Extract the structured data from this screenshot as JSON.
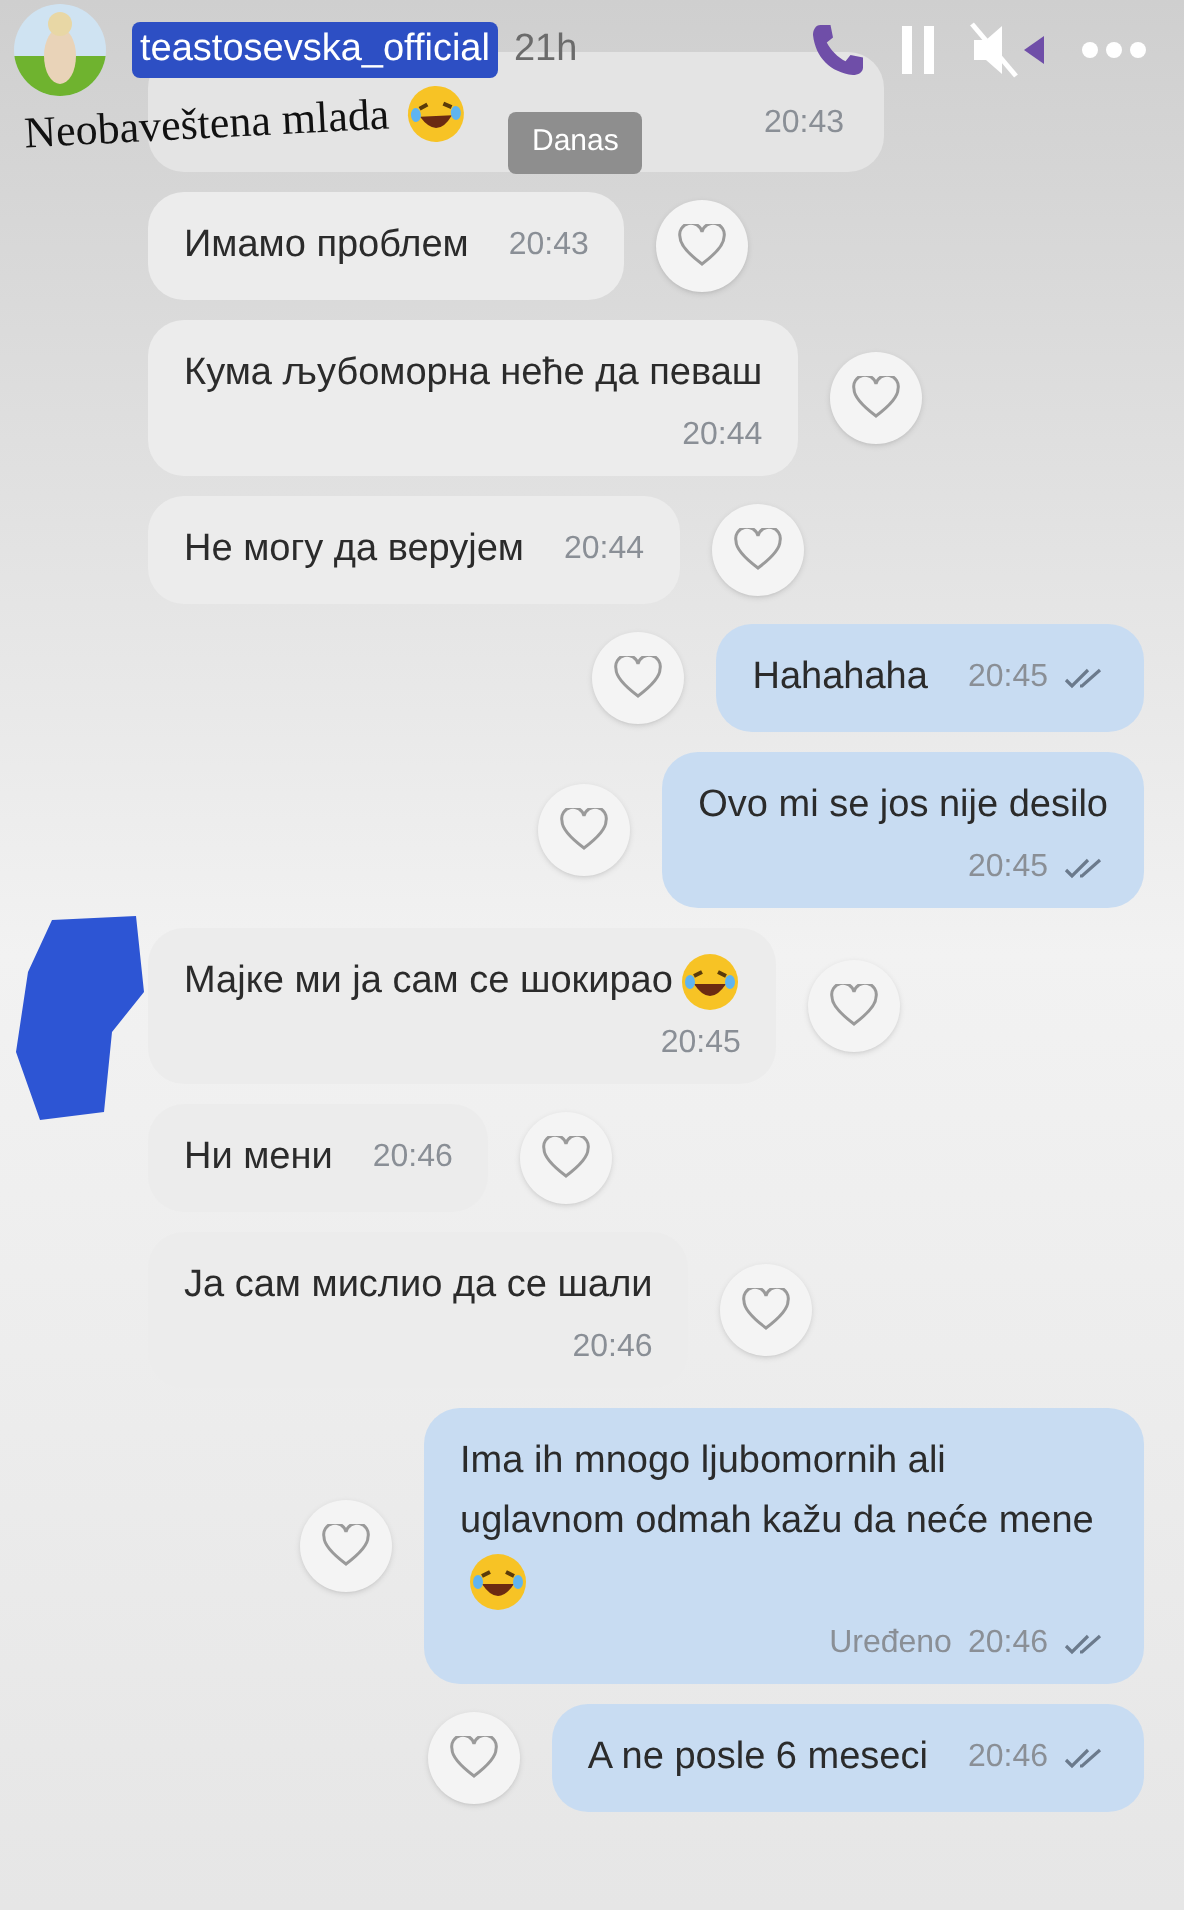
{
  "story": {
    "username": "teastosevska_official",
    "age": "21h",
    "caption": "Neobaveštena mlada"
  },
  "chat": {
    "date_chip": "Danas",
    "first_time": "20:43",
    "messages": [
      {
        "kind": "in",
        "text": "Имамо проблем",
        "time": "20:43",
        "time_below": false,
        "emoji": false
      },
      {
        "kind": "in",
        "text": "Кума љубоморна неће да певаш",
        "time": "20:44",
        "time_below": true,
        "emoji": false
      },
      {
        "kind": "in",
        "text": "Не могу да верујем",
        "time": "20:44",
        "time_below": false,
        "emoji": false
      },
      {
        "kind": "out",
        "text": "Hahahaha",
        "time": "20:45",
        "time_below": false,
        "emoji": false
      },
      {
        "kind": "out",
        "text": "Ovo mi se jos nije desilo",
        "time": "20:45",
        "time_below": true,
        "emoji": false
      },
      {
        "kind": "in",
        "text": "Мајке ми ја сам се шокирао",
        "time": "20:45",
        "time_below": true,
        "emoji": true
      },
      {
        "kind": "in",
        "text": "Ни мени",
        "time": "20:46",
        "time_below": false,
        "emoji": false
      },
      {
        "kind": "in",
        "text": "Ја сам мислио да се шали",
        "time": "20:46",
        "time_below": true,
        "emoji": false
      },
      {
        "kind": "out",
        "text": "Ima ih mnogo ljubomornih ali uglavnom odmah kažu da neće mene",
        "time": "20:46",
        "time_below": true,
        "emoji": true,
        "edited": "Uređeno"
      },
      {
        "kind": "out",
        "text": "A ne posle 6 meseci",
        "time": "20:46",
        "time_below": false,
        "emoji": false
      }
    ]
  }
}
